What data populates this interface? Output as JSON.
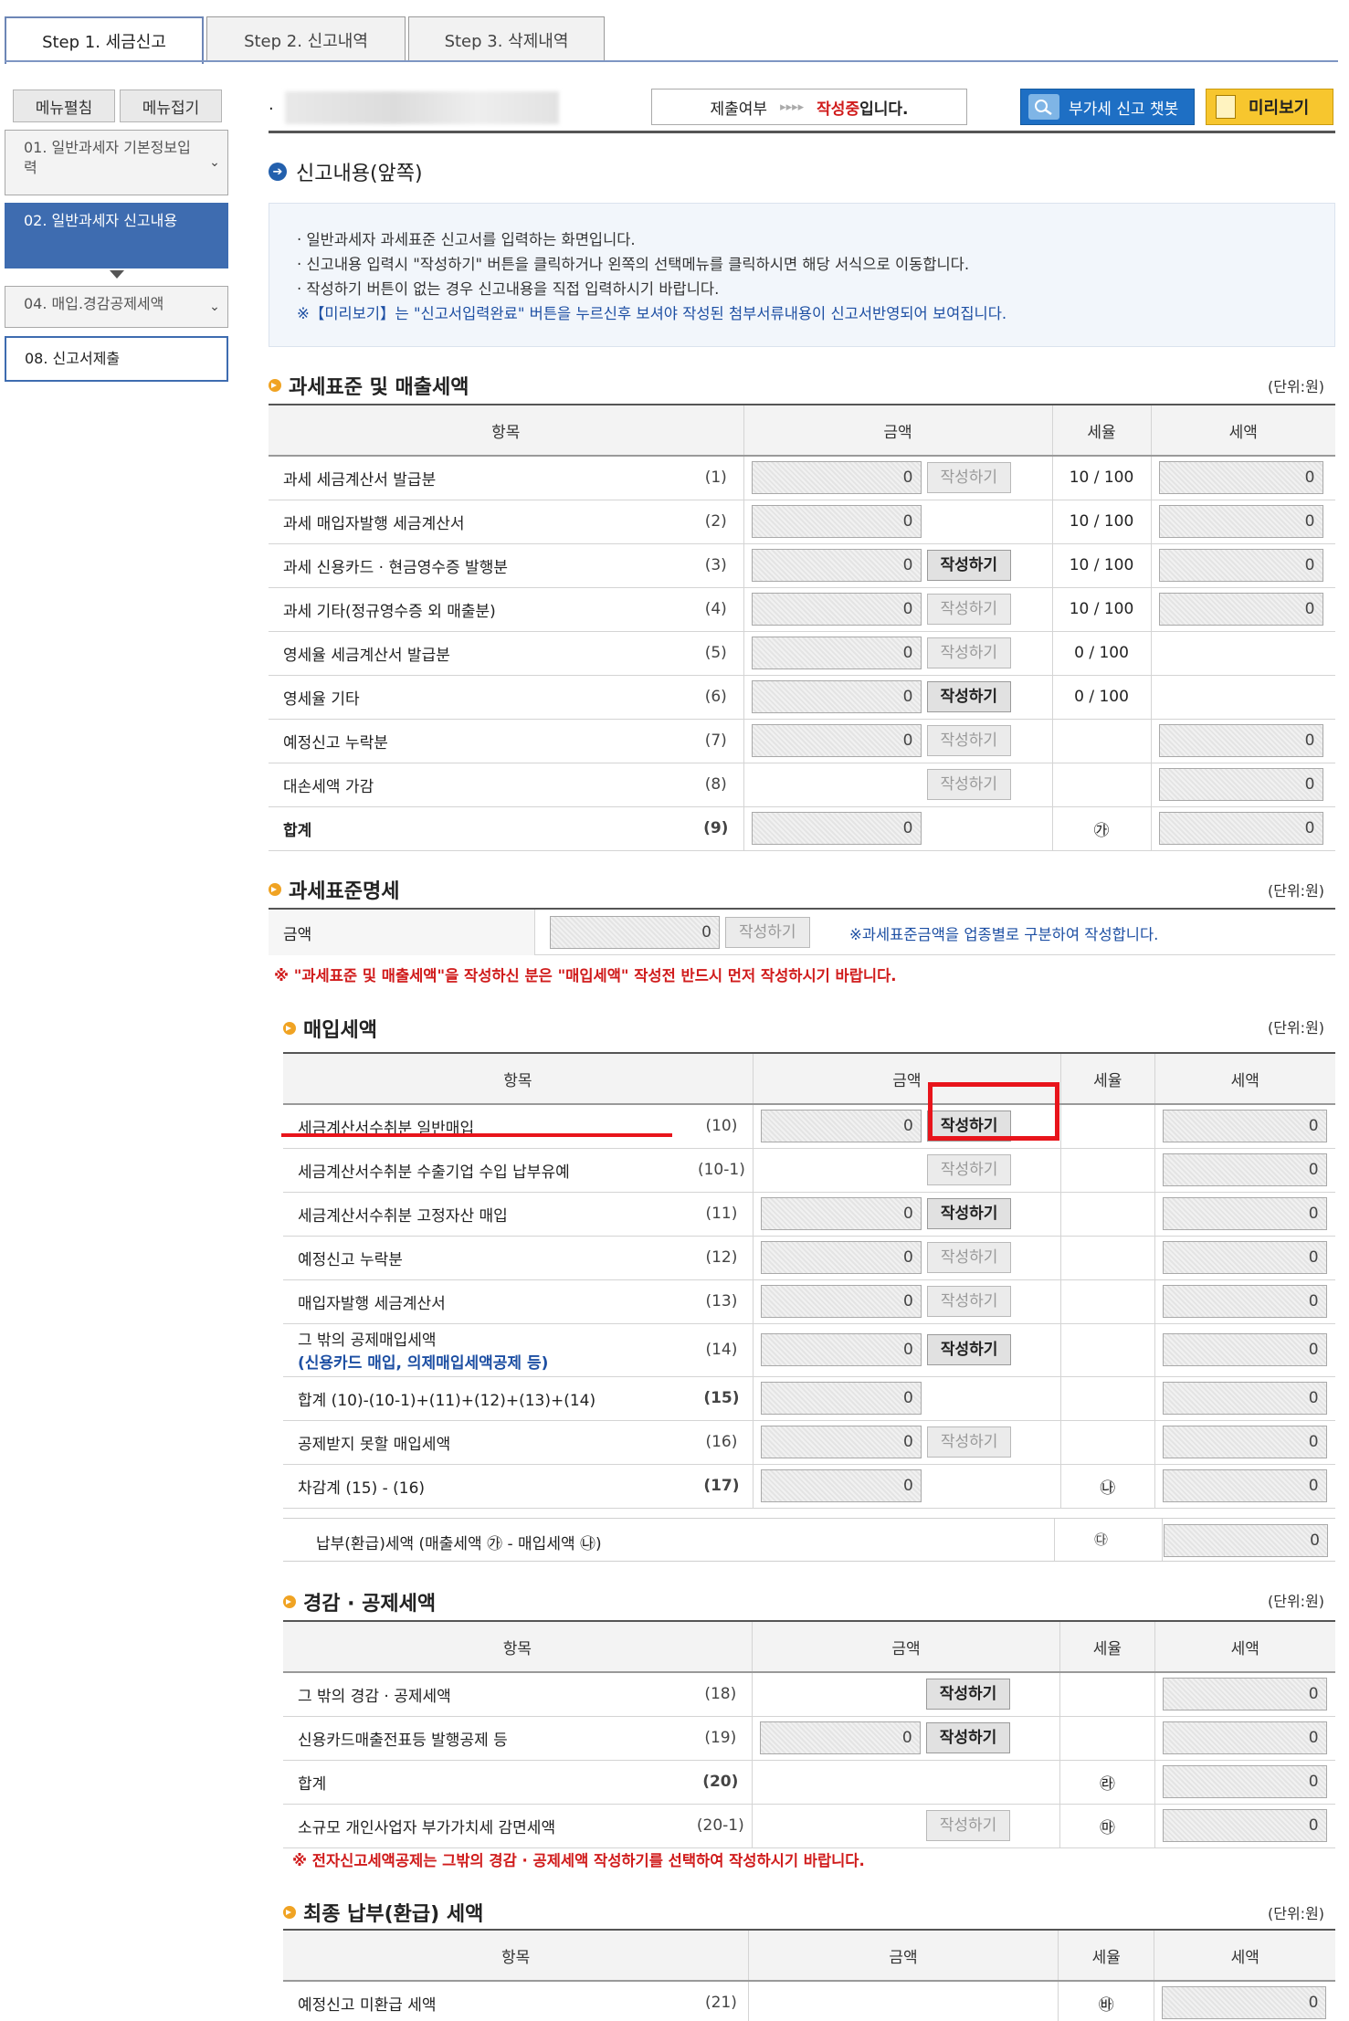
{
  "tabs": [
    "Step 1. 세금신고",
    "Step 2. 신고내역",
    "Step 3. 삭제내역"
  ],
  "sidebar": {
    "expand_label": "메뉴펼침",
    "collapse_label": "메뉴접기",
    "items": [
      {
        "label": "01. 일반과세자 기본정보입력"
      },
      {
        "label": "02. 일반과세자 신고내용"
      },
      {
        "label": "04. 매입.경감공제세액"
      },
      {
        "label": "08. 신고서제출"
      }
    ]
  },
  "header": {
    "dot": ".",
    "status_label": "제출여부",
    "status_arrows": "▸▸▸▸",
    "status_value": "작성중",
    "status_suffix": "입니다.",
    "chatbot_label": "부가세 신고 챗봇",
    "preview_label": "미리보기"
  },
  "page_title": "신고내용(앞쪽)",
  "notice": {
    "lines": [
      "· 일반과세자 과세표준 신고서를 입력하는 화면입니다.",
      "· 신고내용 입력시 \"작성하기\" 버튼을 클릭하거나 왼쪽의 선택메뉴를 클릭하시면 해당 서식으로 이동합니다.",
      "· 작성하기 버튼이 없는 경우 신고내용을 직접 입력하시기 바랍니다."
    ],
    "blue_line": "※【미리보기】는 \"신고서입력완료\" 버튼을 누르신후 보셔야 작성된 첨부서류내용이 신고서반영되어 보여집니다."
  },
  "unit_label": "(단위:원)",
  "headers": {
    "item": "항목",
    "amount": "금액",
    "rate": "세율",
    "tax": "세액"
  },
  "write_label": "작성하기",
  "sec1": {
    "title": "과세표준 및 매출세액",
    "rows": [
      {
        "label": "과세 세금계산서 발급분",
        "num": "(1)",
        "amount": "0",
        "btn": "dim",
        "rate": "10 / 100",
        "tax": "0"
      },
      {
        "label": "과세 매입자발행 세금계산서",
        "num": "(2)",
        "amount": "0",
        "btn": "",
        "rate": "10 / 100",
        "tax": "0"
      },
      {
        "label": "과세 신용카드 · 현금영수증 발행분",
        "num": "(3)",
        "amount": "0",
        "btn": "on",
        "rate": "10 / 100",
        "tax": "0"
      },
      {
        "label": "과세 기타(정규영수증 외 매출분)",
        "num": "(4)",
        "amount": "0",
        "btn": "dim",
        "rate": "10 / 100",
        "tax": "0"
      },
      {
        "label": "영세율 세금계산서 발급분",
        "num": "(5)",
        "amount": "0",
        "btn": "dim",
        "rate": "0 / 100",
        "tax": ""
      },
      {
        "label": "영세율 기타",
        "num": "(6)",
        "amount": "0",
        "btn": "on",
        "rate": "0 / 100",
        "tax": ""
      },
      {
        "label": "예정신고 누락분",
        "num": "(7)",
        "amount": "0",
        "btn": "dim",
        "rate": "",
        "tax": "0"
      },
      {
        "label": "대손세액 가감",
        "num": "(8)",
        "amount": "",
        "btn": "dim",
        "rate": "",
        "tax": "0"
      },
      {
        "label": "합계",
        "num": "(9)",
        "amount": "0",
        "btn": "",
        "rate": "㉮",
        "tax": "0",
        "bold": true
      }
    ]
  },
  "sec2": {
    "title": "과세표준명세",
    "amount_label": "금액",
    "amount": "0",
    "note": "※과세표준금액을 업종별로 구분하여 작성합니다.",
    "warning": "※ \"과세표준 및 매출세액\"을 작성하신 분은 \"매입세액\" 작성전 반드시 먼저 작성하시기 바랍니다."
  },
  "sec3": {
    "title": "매입세액",
    "rows": [
      {
        "label": "세금계산서수취분 일반매입",
        "num": "(10)",
        "amount": "0",
        "btn": "on",
        "rate": "",
        "tax": "0"
      },
      {
        "label": "세금계산서수취분 수출기업 수입 납부유예",
        "num": "(10-1)",
        "amount": "",
        "btn": "dim",
        "rate": "",
        "tax": "0"
      },
      {
        "label": "세금계산서수취분 고정자산 매입",
        "num": "(11)",
        "amount": "0",
        "btn": "on",
        "rate": "",
        "tax": "0"
      },
      {
        "label": "예정신고 누락분",
        "num": "(12)",
        "amount": "0",
        "btn": "dim",
        "rate": "",
        "tax": "0"
      },
      {
        "label": "매입자발행 세금계산서",
        "num": "(13)",
        "amount": "0",
        "btn": "dim",
        "rate": "",
        "tax": "0"
      },
      {
        "label": "그 밖의 공제매입세액",
        "sub": "(신용카드 매입, 의제매입세액공제 등)",
        "num": "(14)",
        "amount": "0",
        "btn": "on",
        "rate": "",
        "tax": "0"
      },
      {
        "label": "합계 (10)-(10-1)+(11)+(12)+(13)+(14)",
        "num": "(15)",
        "amount": "0",
        "btn": "",
        "rate": "",
        "tax": "0"
      },
      {
        "label": "공제받지 못할 매입세액",
        "num": "(16)",
        "amount": "0",
        "btn": "dim",
        "rate": "",
        "tax": "0"
      },
      {
        "label": "차감계 (15) - (16)",
        "num": "(17)",
        "amount": "0",
        "btn": "",
        "rate": "㉯",
        "tax": "0"
      }
    ],
    "payment_label": "납부(환급)세액 (매출세액 ㉮ - 매입세액 ㉯)",
    "payment_mark": "㉰",
    "payment_value": "0"
  },
  "sec4": {
    "title": "경감 · 공제세액",
    "rows": [
      {
        "label": "그 밖의 경감 · 공제세액",
        "num": "(18)",
        "amount": "",
        "btn": "on",
        "rate": "",
        "tax": "0"
      },
      {
        "label": "신용카드매출전표등 발행공제 등",
        "num": "(19)",
        "amount": "0",
        "btn": "on",
        "rate": "",
        "tax": "0"
      },
      {
        "label": "합계",
        "num": "(20)",
        "amount": "",
        "btn": "",
        "rate": "㉱",
        "tax": "0"
      },
      {
        "label": "소규모 개인사업자 부가가치세 감면세액",
        "num": "(20-1)",
        "amount": "",
        "btn": "dim",
        "rate": "㉲",
        "tax": "0"
      }
    ],
    "warning": "※ 전자신고세액공제는 그밖의 경감 · 공제세액 작성하기를 선택하여 작성하시기 바랍니다."
  },
  "sec5": {
    "title": "최종 납부(환급) 세액",
    "rows": [
      {
        "label": "예정신고 미환급 세액",
        "num": "(21)",
        "rate": "㉳",
        "tax": "0"
      }
    ]
  },
  "colors": {
    "accent": "#3e6cb0",
    "highlight": "#e8141b",
    "warning": "#d01b1b",
    "preview": "#f7c62e"
  }
}
